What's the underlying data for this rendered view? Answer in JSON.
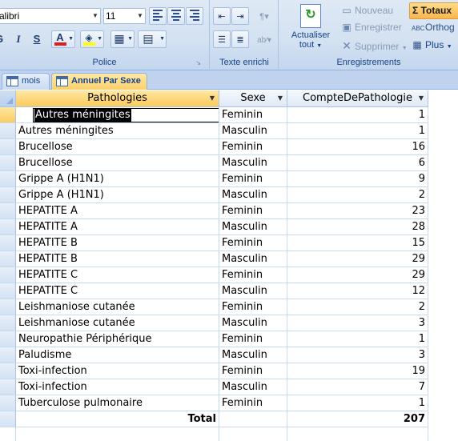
{
  "ribbon": {
    "font_name": "alibri",
    "font_size": "11",
    "groups": {
      "police": "Police",
      "texte_enrichi": "Texte enrichi",
      "enregistrements": "Enregistrements"
    },
    "buttons": {
      "bold": "G",
      "italic": "I",
      "underline": "S",
      "font_color": "A",
      "actualiser_line1": "Actualiser",
      "actualiser_line2": "tout",
      "nouveau": "Nouveau",
      "enregistrer": "Enregistrer",
      "supprimer": "Supprimer",
      "totaux": "Totaux",
      "orthographe": "Orthog",
      "plus": "Plus"
    },
    "colors": {
      "font_color": "#e01e1e",
      "highlight_color": "#ffff00"
    }
  },
  "tabs": [
    {
      "label": "mois",
      "active": false
    },
    {
      "label": "Annuel Par Sexe",
      "active": true
    }
  ],
  "table": {
    "columns": [
      "Pathologies",
      "Sexe",
      "CompteDePathologie"
    ],
    "rows": [
      {
        "pathologie": "Autres méningites",
        "sexe": "Feminin",
        "compte": "1"
      },
      {
        "pathologie": "Autres méningites",
        "sexe": "Masculin",
        "compte": "1"
      },
      {
        "pathologie": "Brucellose",
        "sexe": "Feminin",
        "compte": "16"
      },
      {
        "pathologie": "Brucellose",
        "sexe": "Masculin",
        "compte": "6"
      },
      {
        "pathologie": "Grippe A (H1N1)",
        "sexe": "Feminin",
        "compte": "9"
      },
      {
        "pathologie": "Grippe A (H1N1)",
        "sexe": "Masculin",
        "compte": "2"
      },
      {
        "pathologie": "HEPATITE A",
        "sexe": "Feminin",
        "compte": "23"
      },
      {
        "pathologie": "HEPATITE A",
        "sexe": "Masculin",
        "compte": "28"
      },
      {
        "pathologie": "HEPATITE B",
        "sexe": "Feminin",
        "compte": "15"
      },
      {
        "pathologie": "HEPATITE B",
        "sexe": "Masculin",
        "compte": "29"
      },
      {
        "pathologie": "HEPATITE C",
        "sexe": "Feminin",
        "compte": "29"
      },
      {
        "pathologie": "HEPATITE C",
        "sexe": "Masculin",
        "compte": "12"
      },
      {
        "pathologie": "Leishmaniose cutanée",
        "sexe": "Feminin",
        "compte": "2"
      },
      {
        "pathologie": "Leishmaniose cutanée",
        "sexe": "Masculin",
        "compte": "3"
      },
      {
        "pathologie": "Neuropathie Périphérique",
        "sexe": "Feminin",
        "compte": "1"
      },
      {
        "pathologie": "Paludisme",
        "sexe": "Masculin",
        "compte": "3"
      },
      {
        "pathologie": "Toxi-infection",
        "sexe": "Feminin",
        "compte": "19"
      },
      {
        "pathologie": "Toxi-infection",
        "sexe": "Masculin",
        "compte": "7"
      },
      {
        "pathologie": "Tuberculose pulmonaire",
        "sexe": "Feminin",
        "compte": "1"
      }
    ],
    "total_label": "Total",
    "total_value": "207"
  }
}
